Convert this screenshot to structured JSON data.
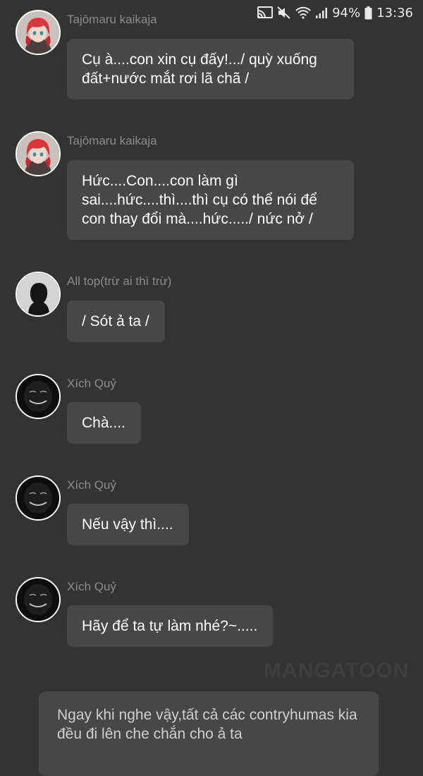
{
  "status_bar": {
    "battery": "94%",
    "time": "13:36"
  },
  "messages": [
    {
      "sender": "Tajōmaru kaikaja",
      "avatar": "redhead-girl-avatar",
      "text": "Cụ à....con xin cụ đấy!.../ quỳ xuống đất+nước mắt rơi lã chã /"
    },
    {
      "sender": "Tajōmaru kaikaja",
      "avatar": "redhead-girl-avatar",
      "text": "Hức....Con....con làm gì sai....hức....thì....thì cụ có thể nói để con thay đổi mà....hức...../ nức nở /"
    },
    {
      "sender": "All top(trừ ai thì trừ)",
      "avatar": "silhouette-avatar",
      "text": "/ Sót ả ta /"
    },
    {
      "sender": "Xích Quỷ",
      "avatar": "dark-grin-avatar",
      "text": "Chà...."
    },
    {
      "sender": "Xích Quỷ",
      "avatar": "dark-grin-avatar",
      "text": "Nếu vậy thì...."
    },
    {
      "sender": "Xích Quỷ",
      "avatar": "dark-grin-avatar",
      "text": "Hãy để ta tự làm nhé?~....."
    }
  ],
  "watermark": "MANGATOON",
  "narration": "Ngay khi nghe vậy,tất cả các contryhumas kia đều đi lên che chắn cho ả ta"
}
